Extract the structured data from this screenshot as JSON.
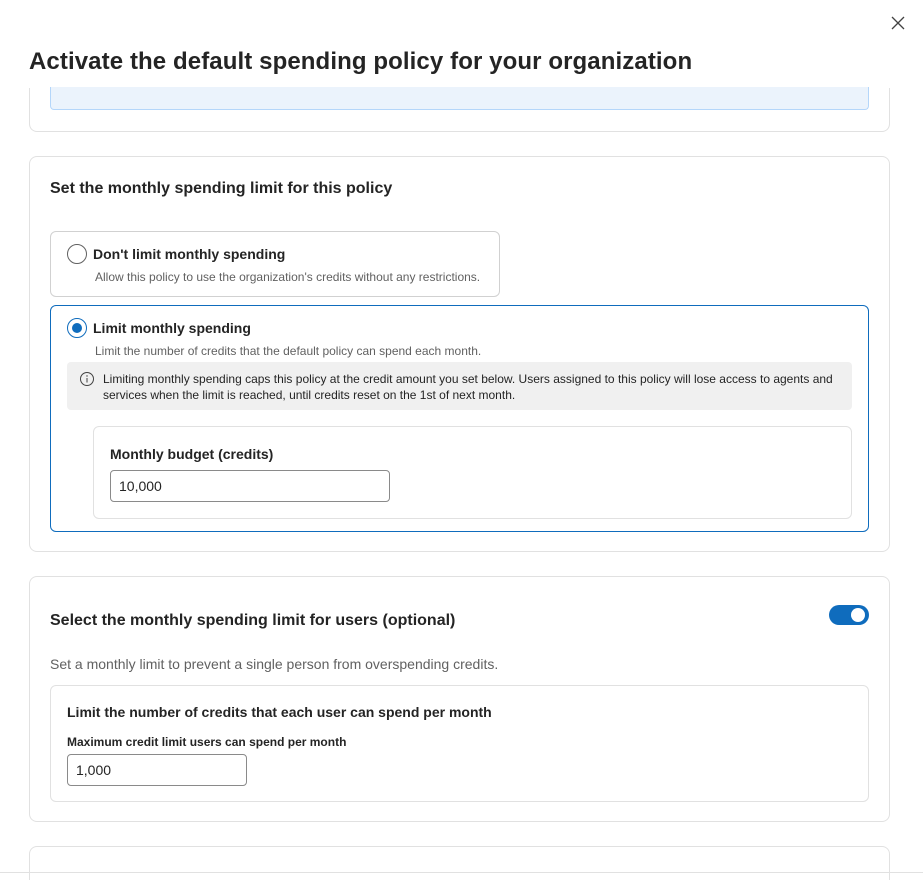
{
  "header": {
    "title": "Activate the default spending policy for your organization",
    "close_icon": "close-icon"
  },
  "policy_section": {
    "title": "Set the monthly spending limit for this policy",
    "options": [
      {
        "label": "Don't limit monthly spending",
        "description": "Allow this policy to use the organization's credits without any restrictions.",
        "selected": false
      },
      {
        "label": "Limit monthly spending",
        "description": "Limit the number of credits that the default policy can spend each month.",
        "selected": true
      }
    ],
    "notice": {
      "icon": "info-icon",
      "text": "Limiting monthly spending caps this policy at the credit amount you set below. Users assigned to this policy will lose access to agents and services when the limit is reached, until credits reset on the 1st of next month."
    },
    "budget": {
      "label": "Monthly budget (credits)",
      "value": "10,000"
    }
  },
  "users_section": {
    "title": "Select the monthly spending limit for users (optional)",
    "toggle_on": true,
    "description": "Set a monthly limit to prevent a single person from overspending credits.",
    "limit_box": {
      "title": "Limit the number of credits that each user can spend per month",
      "field_label": "Maximum credit limit users can spend per month",
      "value": "1,000"
    }
  },
  "colors": {
    "accent": "#0f6cbd",
    "info_background": "#ebf3fc",
    "notice_background": "#f0f0f0"
  }
}
